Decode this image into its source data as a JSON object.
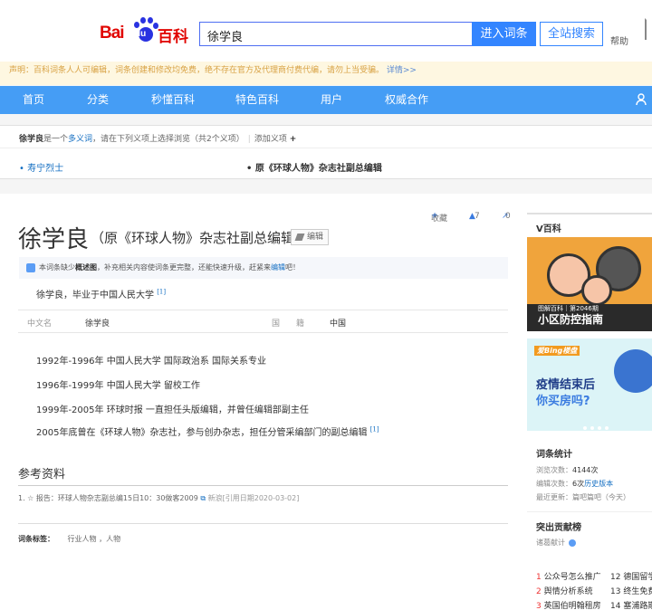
{
  "header": {
    "logo_bai": "Bai",
    "logo_du": "du",
    "logo_baike": "百科",
    "search_value": "徐学良",
    "enter_button": "进入词条",
    "search_all_button": "全站搜索",
    "help_link": "帮助"
  },
  "notice": {
    "text": "声明：百科词条人人可编辑，词条创建和修改均免费，绝不存在官方及代理商付费代编，请勿上当受骗。",
    "more_link": "详情>>"
  },
  "nav": {
    "items": [
      "首页",
      "分类",
      "秒懂百科",
      "特色百科",
      "用户",
      "权威合作"
    ],
    "user_label": "个"
  },
  "polysemy": {
    "name": "徐学良",
    "tip_part1": "是一个",
    "tip_link": "多义词",
    "tip_part2": "，请在下列义项上选择浏览（共2个义项）",
    "add_label": "添加义项",
    "add_symbol": "+",
    "item1": "寿宁烈士",
    "item2": "原《环球人物》杂志社副总编辑"
  },
  "article": {
    "title": "徐学良",
    "subtitle": "（原《环球人物》杂志社副总编辑）",
    "edit_button": "编辑",
    "collect_label": "收藏",
    "like_count": "7",
    "share_count": "0",
    "tip_text_1": "本词条缺少",
    "tip_bold": "概述图",
    "tip_text_2": "，补充相关内容使词条更完整，还能快速升级，赶紧来",
    "tip_link": "编辑",
    "tip_text_3": "吧！",
    "summary": "徐学良，毕业于中国人民大学",
    "summary_ref": "[1]",
    "basic_info": {
      "k1": "中文名",
      "v1": "徐学良",
      "k2": "国　　籍",
      "v2": "中国"
    },
    "timeline": [
      {
        "year": "1992年-1996年",
        "text": "中国人民大学 国际政治系 国际关系专业",
        "ref": ""
      },
      {
        "year": "1996年-1999年",
        "text": "中国人民大学 留校工作",
        "ref": ""
      },
      {
        "year": "1999年-2005年",
        "text": "环球时报 一直担任头版编辑，并曾任编辑部副主任",
        "ref": ""
      },
      {
        "year": "2005年",
        "text": "底曾在《环球人物》杂志社，参与创办杂志，担任分管采编部门的副总编辑",
        "ref": "[1]"
      }
    ],
    "references": {
      "heading": "参考资料",
      "item1": "1. ☆  报告：环球人物杂志副总编15日10：30做客2009",
      "item1_site": "新浪",
      "item1_date": "[引用日期2020-03-02]"
    },
    "tags": {
      "label": "词条标签：",
      "values": "行业人物 ，人物"
    }
  },
  "sidebar": {
    "heading": "V百科",
    "ad1_caption": "图解百科｜第2046期",
    "ad1_title": "小区防控指南",
    "ad2_brand": "爱Bing楼盘",
    "ad2_line1": "疫情结束后",
    "ad2_line2": "你买房吗?",
    "stats_heading": "词条统计",
    "views_label": "浏览次数：",
    "views_value": "4144次",
    "edits_label": "编辑次数：",
    "edits_value": "6次",
    "edits_link": "历史版本",
    "updated_label": "最近更新：",
    "updated_value": "篇吧篇吧（今天）",
    "contrib_heading": "突出贡献榜",
    "contrib_name": "诸葛献计",
    "hot": [
      {
        "num": "1",
        "text": "公众号怎么推广"
      },
      {
        "num": "2",
        "text": "舆情分析系统"
      },
      {
        "num": "3",
        "text": "英国伯明翰租房"
      },
      {
        "num": "12",
        "text": "德国留学"
      },
      {
        "num": "13",
        "text": "终生免费"
      },
      {
        "num": "14",
        "text": "塞浦路斯"
      }
    ]
  },
  "colors": {
    "nav_blue": "#459df5",
    "brand_red": "#e10602",
    "link_blue": "#136ec2"
  }
}
